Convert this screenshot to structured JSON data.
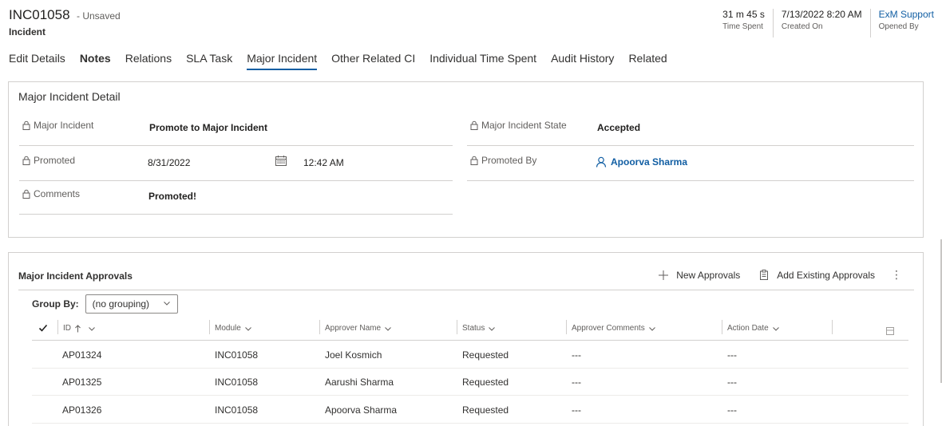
{
  "header": {
    "record_id": "INC01058",
    "record_state": "- Unsaved",
    "record_type": "Incident",
    "stats": [
      {
        "value": "31 m 45 s",
        "label": "Time Spent"
      },
      {
        "value": "7/13/2022 8:20 AM",
        "label": "Created On"
      },
      {
        "value": "ExM Support",
        "label": "Opened By"
      }
    ]
  },
  "tabs": [
    {
      "label": "Edit Details"
    },
    {
      "label": "Notes"
    },
    {
      "label": "Relations"
    },
    {
      "label": "SLA Task"
    },
    {
      "label": "Major Incident"
    },
    {
      "label": "Other Related CI"
    },
    {
      "label": "Individual Time Spent"
    },
    {
      "label": "Audit History"
    },
    {
      "label": "Related"
    }
  ],
  "detail": {
    "title": "Major Incident Detail",
    "major_incident": {
      "label": "Major Incident",
      "value": "Promote to Major Incident"
    },
    "promoted": {
      "label": "Promoted",
      "date": "8/31/2022",
      "time": "12:42 AM"
    },
    "comments": {
      "label": "Comments",
      "value": "Promoted!"
    },
    "state": {
      "label": "Major Incident State",
      "value": "Accepted"
    },
    "promoted_by": {
      "label": "Promoted By",
      "value": "Apoorva Sharma"
    }
  },
  "approvals": {
    "title": "Major Incident Approvals",
    "new_label": "New Approvals",
    "add_existing_label": "Add Existing Approvals",
    "more_label": "⋮",
    "group_by_label": "Group By:",
    "group_by_value": "(no grouping)",
    "columns": [
      "ID",
      "Module",
      "Approver Name",
      "Status",
      "Approver Comments",
      "Action Date"
    ],
    "rows": [
      [
        "AP01324",
        "INC01058",
        "Joel Kosmich",
        "Requested",
        "---",
        "---"
      ],
      [
        "AP01325",
        "INC01058",
        "Aarushi Sharma",
        "Requested",
        "---",
        "---"
      ],
      [
        "AP01326",
        "INC01058",
        "Apoorva Sharma",
        "Requested",
        "---",
        "---"
      ]
    ]
  }
}
